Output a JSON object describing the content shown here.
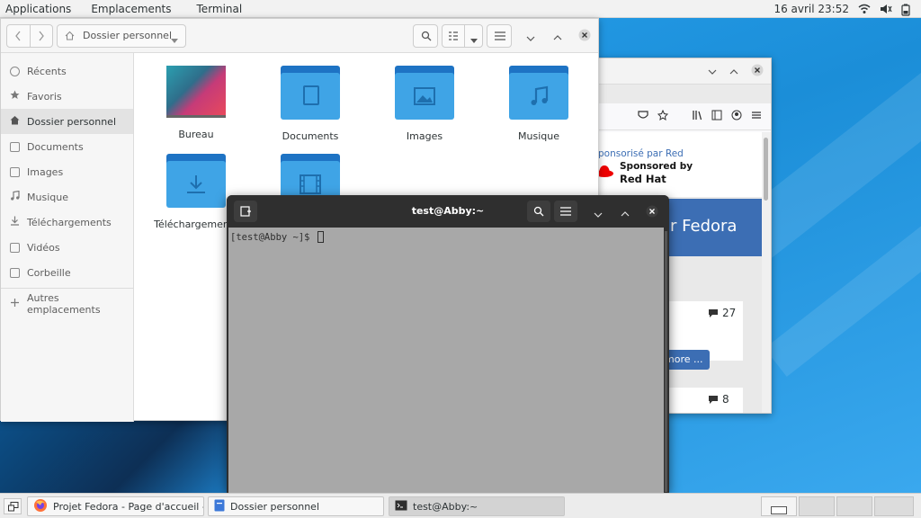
{
  "topbar": {
    "menus": [
      "Applications",
      "Emplacements",
      "Terminal"
    ],
    "clock": "16 avril  23:52",
    "icons": [
      "wifi-icon",
      "volume-icon",
      "battery-icon"
    ]
  },
  "files": {
    "path_label": "Dossier personnel",
    "sidebar": [
      {
        "label": "Récents",
        "icon": "clock-icon"
      },
      {
        "label": "Favoris",
        "icon": "star-icon"
      },
      {
        "label": "Dossier personnel",
        "icon": "home-icon"
      },
      {
        "label": "Documents",
        "icon": "document-icon"
      },
      {
        "label": "Images",
        "icon": "image-icon"
      },
      {
        "label": "Musique",
        "icon": "music-icon"
      },
      {
        "label": "Téléchargements",
        "icon": "download-icon"
      },
      {
        "label": "Vidéos",
        "icon": "video-icon"
      },
      {
        "label": "Corbeille",
        "icon": "trash-icon"
      },
      {
        "label": "Autres emplacements",
        "icon": "plus-icon"
      }
    ],
    "items": [
      {
        "label": "Bureau"
      },
      {
        "label": "Documents"
      },
      {
        "label": "Images"
      },
      {
        "label": "Musique"
      },
      {
        "label": "Téléchargements"
      },
      {
        "label": ""
      }
    ]
  },
  "browser": {
    "sponsored_text": "ponsorisé par Red",
    "sponsored_by": "Sponsored by",
    "brand": "Red Hat",
    "banner_text": "r Fedora",
    "count1": "27",
    "count2": "8",
    "more_label": "more ..."
  },
  "terminal": {
    "title": "test@Abby:~",
    "prompt": "[test@Abby ~]$ "
  },
  "taskbar": {
    "tasks": [
      {
        "label": "Projet Fedora - Page d'accueil - Mo..."
      },
      {
        "label": "Dossier personnel"
      },
      {
        "label": "test@Abby:~"
      }
    ]
  },
  "colors": {
    "accent_blue": "#3c6eb4",
    "folder_blue": "#3fa4e6",
    "redhat_red": "#ee0000"
  }
}
